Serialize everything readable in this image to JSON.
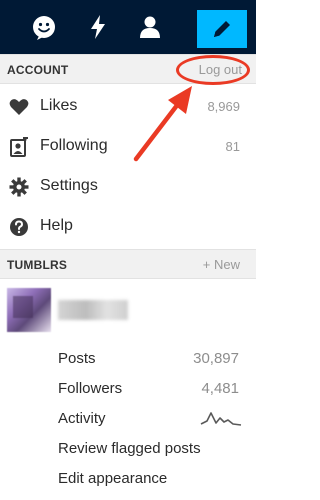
{
  "topbar": {
    "background": "#001935",
    "active_accent": "#00b8ff",
    "icons": [
      "smiley-face-icon",
      "lightning-bolt-icon",
      "person-icon",
      "pencil-icon"
    ]
  },
  "account": {
    "header": "ACCOUNT",
    "logout_label": "Log out",
    "items": [
      {
        "label": "Likes",
        "count": "8,969",
        "icon": "heart-icon"
      },
      {
        "label": "Following",
        "count": "81",
        "icon": "following-icon"
      },
      {
        "label": "Settings",
        "count": "",
        "icon": "gear-icon"
      },
      {
        "label": "Help",
        "count": "",
        "icon": "question-icon"
      }
    ]
  },
  "tumblrs": {
    "header": "TUMBLRS",
    "new_label": "+ New",
    "blog": {
      "rows": [
        {
          "label": "Posts",
          "value": "30,897"
        },
        {
          "label": "Followers",
          "value": "4,481"
        },
        {
          "label": "Activity",
          "value": ""
        },
        {
          "label": "Review flagged posts",
          "value": ""
        },
        {
          "label": "Edit appearance",
          "value": ""
        }
      ]
    }
  },
  "annotation": {
    "color": "#ea3a24"
  }
}
